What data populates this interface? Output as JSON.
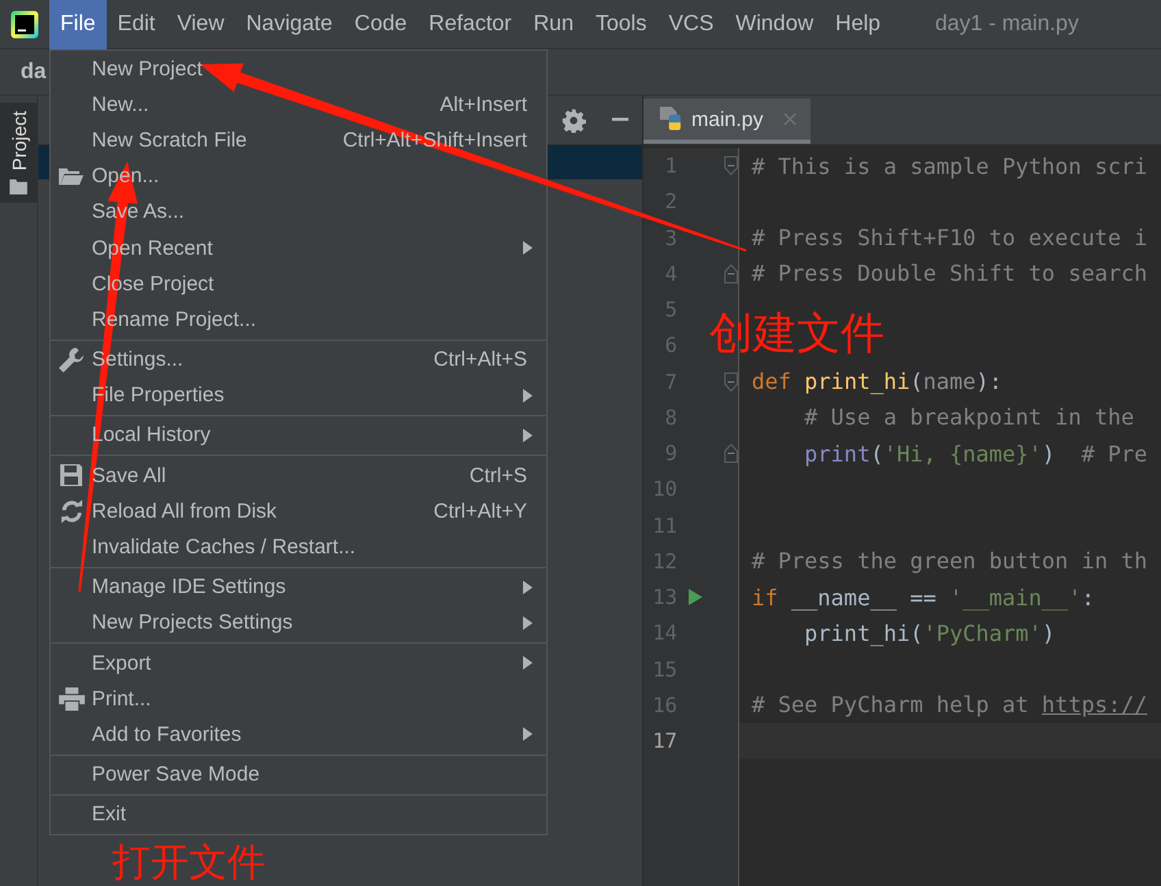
{
  "window": {
    "title": "day1 - main.py"
  },
  "menubar": [
    {
      "label": "File",
      "selected": true
    },
    {
      "label": "Edit",
      "selected": false
    },
    {
      "label": "View",
      "selected": false
    },
    {
      "label": "Navigate",
      "selected": false
    },
    {
      "label": "Code",
      "selected": false
    },
    {
      "label": "Refactor",
      "selected": false
    },
    {
      "label": "Run",
      "selected": false
    },
    {
      "label": "Tools",
      "selected": false
    },
    {
      "label": "VCS",
      "selected": false
    },
    {
      "label": "Window",
      "selected": false
    },
    {
      "label": "Help",
      "selected": false
    }
  ],
  "toolbar": {
    "project_name": "da"
  },
  "side_tabs": [
    {
      "label": "Project",
      "selected": true
    }
  ],
  "file_menu": [
    [
      {
        "kind": "plain",
        "label": "New Project",
        "submenu": false
      },
      {
        "kind": "plain",
        "label": "New...",
        "shortcut": "Alt+Insert",
        "submenu": false
      },
      {
        "kind": "plain",
        "label": "New Scratch File",
        "shortcut": "Ctrl+Alt+Shift+Insert",
        "submenu": false
      },
      {
        "kind": "folder",
        "label": "Open...",
        "submenu": false
      },
      {
        "kind": "plain",
        "label": "Save As...",
        "submenu": false
      },
      {
        "kind": "plain",
        "label": "Open Recent",
        "submenu": true
      },
      {
        "kind": "plain",
        "label": "Close Project",
        "submenu": false
      },
      {
        "kind": "plain",
        "label": "Rename Project...",
        "submenu": false
      }
    ],
    [
      {
        "kind": "wrench",
        "label": "Settings...",
        "shortcut": "Ctrl+Alt+S",
        "submenu": false
      },
      {
        "kind": "plain",
        "label": "File Properties",
        "submenu": true
      }
    ],
    [
      {
        "kind": "plain",
        "label": "Local History",
        "submenu": true
      }
    ],
    [
      {
        "kind": "disk",
        "label": "Save All",
        "shortcut": "Ctrl+S",
        "submenu": false
      },
      {
        "kind": "reload",
        "label": "Reload All from Disk",
        "shortcut": "Ctrl+Alt+Y",
        "submenu": false
      },
      {
        "kind": "plain",
        "label": "Invalidate Caches / Restart...",
        "submenu": false
      }
    ],
    [
      {
        "kind": "plain",
        "label": "Manage IDE Settings",
        "submenu": true
      },
      {
        "kind": "plain",
        "label": "New Projects Settings",
        "submenu": true
      }
    ],
    [
      {
        "kind": "plain",
        "label": "Export",
        "submenu": true
      },
      {
        "kind": "printer",
        "label": "Print...",
        "submenu": false
      },
      {
        "kind": "plain",
        "label": "Add to Favorites",
        "submenu": true
      }
    ],
    [
      {
        "kind": "plain",
        "label": "Power Save Mode",
        "submenu": false
      }
    ],
    [
      {
        "kind": "plain",
        "label": "Exit",
        "submenu": false
      }
    ]
  ],
  "editor_tabs": [
    {
      "label": "main.py",
      "selected": true
    }
  ],
  "code_lines": [
    {
      "number": "1",
      "current": false,
      "run": false,
      "fold_start": true,
      "fold_end": false,
      "tokens": [
        {
          "kind": "comment",
          "text": "# This is a sample Python scri"
        }
      ]
    },
    {
      "number": "2",
      "current": false,
      "run": false,
      "fold_start": false,
      "fold_end": false
    },
    {
      "number": "3",
      "current": false,
      "run": false,
      "fold_start": false,
      "fold_end": false,
      "tokens": [
        {
          "kind": "comment",
          "text": "# Press Shift+F10 to execute i"
        }
      ]
    },
    {
      "number": "4",
      "current": false,
      "run": false,
      "fold_start": false,
      "fold_end": true,
      "tokens": [
        {
          "kind": "comment",
          "text": "# Press Double Shift to search"
        }
      ]
    },
    {
      "number": "5",
      "current": false,
      "run": false,
      "fold_start": false,
      "fold_end": false
    },
    {
      "number": "6",
      "current": false,
      "run": false,
      "fold_start": false,
      "fold_end": false
    },
    {
      "number": "7",
      "current": false,
      "run": false,
      "fold_start": true,
      "fold_end": false,
      "tokens": [
        {
          "kind": "keyword",
          "text": "def"
        },
        {
          "kind": "function",
          "text": " print_hi"
        },
        {
          "kind": "plain",
          "text": "("
        },
        {
          "kind": "param",
          "text": "name"
        },
        {
          "kind": "plain",
          "text": "):"
        }
      ]
    },
    {
      "number": "8",
      "current": false,
      "run": false,
      "fold_start": false,
      "fold_end": false,
      "tokens": [
        {
          "kind": "comment",
          "text": "    # Use a breakpoint in the"
        }
      ]
    },
    {
      "number": "9",
      "current": false,
      "run": false,
      "fold_start": false,
      "fold_end": true,
      "tokens": [
        {
          "kind": "builtin",
          "text": "    print"
        },
        {
          "kind": "plain",
          "text": "("
        },
        {
          "kind": "string",
          "text": "'Hi, {name}'"
        },
        {
          "kind": "plain",
          "text": ")"
        },
        {
          "kind": "comment",
          "text": "  # Pre"
        }
      ]
    },
    {
      "number": "10",
      "current": false,
      "run": false,
      "fold_start": false,
      "fold_end": false
    },
    {
      "number": "11",
      "current": false,
      "run": false,
      "fold_start": false,
      "fold_end": false
    },
    {
      "number": "12",
      "current": false,
      "run": false,
      "fold_start": false,
      "fold_end": false,
      "tokens": [
        {
          "kind": "comment",
          "text": "# Press the green button in th"
        }
      ]
    },
    {
      "number": "13",
      "current": false,
      "run": true,
      "fold_start": false,
      "fold_end": false,
      "tokens": [
        {
          "kind": "keyword",
          "text": "if"
        },
        {
          "kind": "plain",
          "text": " __name__ == "
        },
        {
          "kind": "string",
          "text": "'__main__'"
        },
        {
          "kind": "plain",
          "text": ":"
        }
      ]
    },
    {
      "number": "14",
      "current": false,
      "run": false,
      "fold_start": false,
      "fold_end": false,
      "tokens": [
        {
          "kind": "plain",
          "text": "    print_hi("
        },
        {
          "kind": "string",
          "text": "'PyCharm'"
        },
        {
          "kind": "plain",
          "text": ")"
        }
      ]
    },
    {
      "number": "15",
      "current": false,
      "run": false,
      "fold_start": false,
      "fold_end": false
    },
    {
      "number": "16",
      "current": false,
      "run": false,
      "fold_start": false,
      "fold_end": false,
      "tokens": [
        {
          "kind": "comment",
          "text": "# See PyCharm help at "
        },
        {
          "kind": "link",
          "text": "https://"
        }
      ]
    },
    {
      "number": "17",
      "current": true,
      "run": false,
      "fold_start": false,
      "fold_end": false
    }
  ],
  "annotations": [
    {
      "text": "创建文件"
    },
    {
      "text": "打开文件"
    }
  ]
}
